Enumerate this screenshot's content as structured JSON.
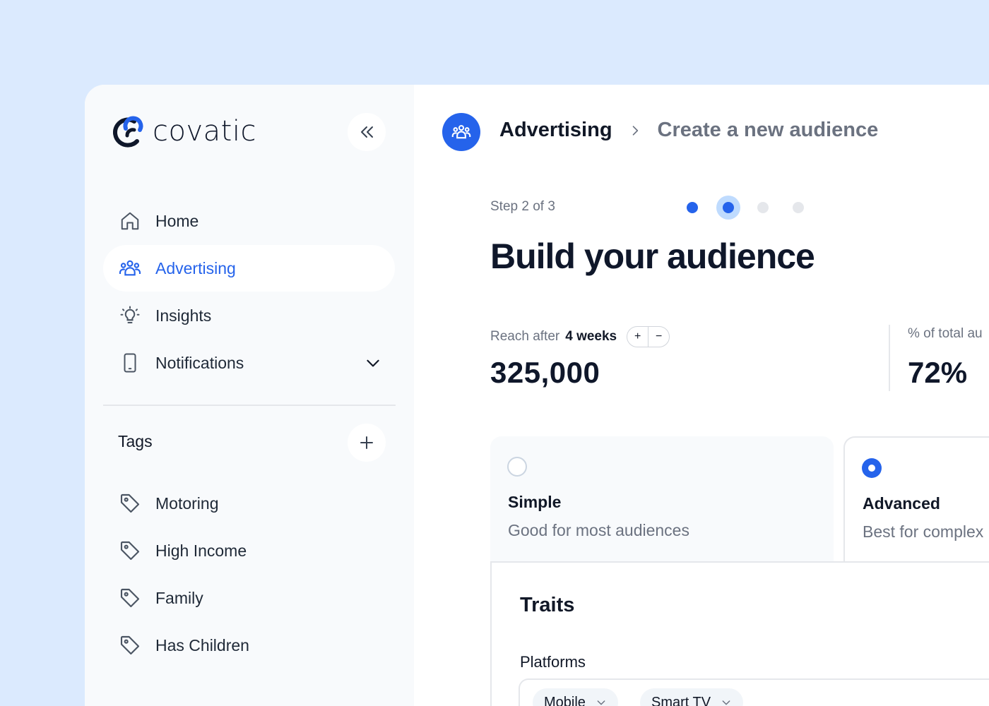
{
  "brand": {
    "name": "covatic",
    "accent": "#2563eb"
  },
  "sidebar": {
    "nav": [
      {
        "label": "Home",
        "icon": "home-icon"
      },
      {
        "label": "Advertising",
        "icon": "audience-icon",
        "active": true
      },
      {
        "label": "Insights",
        "icon": "lightbulb-icon"
      },
      {
        "label": "Notifications",
        "icon": "phone-icon",
        "expandable": true
      }
    ],
    "tags_title": "Tags",
    "tags": [
      {
        "label": "Motoring"
      },
      {
        "label": "High Income"
      },
      {
        "label": "Family"
      },
      {
        "label": "Has Children"
      }
    ]
  },
  "header": {
    "breadcrumb": [
      "Advertising",
      "Create a new audience"
    ]
  },
  "wizard": {
    "step_label": "Step 2 of 3",
    "current_step": 2,
    "total_dots": 4,
    "title": "Build your audience"
  },
  "reach": {
    "label": "Reach after",
    "weeks": "4 weeks",
    "plus": "+",
    "minus": "−",
    "value": "325,000"
  },
  "percent": {
    "label": "% of total au",
    "value": "72%"
  },
  "options": {
    "simple": {
      "title": "Simple",
      "description": "Good for most audiences",
      "selected": false
    },
    "advanced": {
      "title": "Advanced",
      "description": "Best for complex",
      "selected": true
    }
  },
  "traits": {
    "title": "Traits",
    "platforms_label": "Platforms",
    "chips": [
      "Mobile",
      "Smart TV"
    ]
  }
}
